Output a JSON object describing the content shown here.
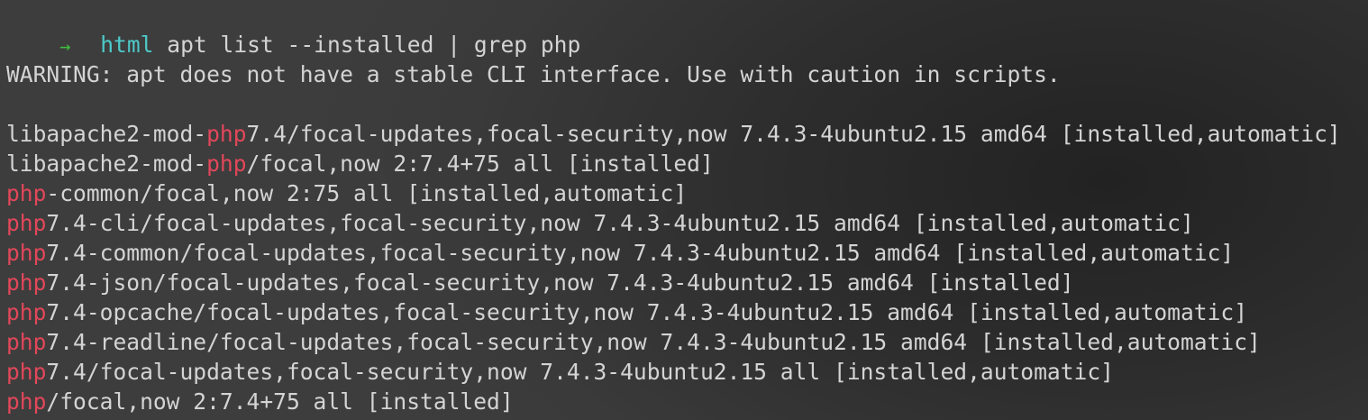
{
  "theme": {
    "background": "#3b3b3b",
    "foreground": "#d4d4d4",
    "prompt_arrow_color": "#3fbf3f",
    "prompt_dir_color": "#4ec9c9",
    "match_highlight_color": "#e2475a"
  },
  "prompt": {
    "arrow": "→",
    "directory": "html",
    "command": "apt list --installed | grep php"
  },
  "warning": "WARNING: apt does not have a stable CLI interface. Use with caution in scripts.",
  "results": [
    {
      "pre": "libapache2-mod-",
      "match": "php",
      "post": "7.4/focal-updates,focal-security,now 7.4.3-4ubuntu2.15 amd64 [installed,automatic]"
    },
    {
      "pre": "libapache2-mod-",
      "match": "php",
      "post": "/focal,now 2:7.4+75 all [installed]"
    },
    {
      "pre": "",
      "match": "php",
      "post": "-common/focal,now 2:75 all [installed,automatic]"
    },
    {
      "pre": "",
      "match": "php",
      "post": "7.4-cli/focal-updates,focal-security,now 7.4.3-4ubuntu2.15 amd64 [installed,automatic]"
    },
    {
      "pre": "",
      "match": "php",
      "post": "7.4-common/focal-updates,focal-security,now 7.4.3-4ubuntu2.15 amd64 [installed,automatic]"
    },
    {
      "pre": "",
      "match": "php",
      "post": "7.4-json/focal-updates,focal-security,now 7.4.3-4ubuntu2.15 amd64 [installed]"
    },
    {
      "pre": "",
      "match": "php",
      "post": "7.4-opcache/focal-updates,focal-security,now 7.4.3-4ubuntu2.15 amd64 [installed,automatic]"
    },
    {
      "pre": "",
      "match": "php",
      "post": "7.4-readline/focal-updates,focal-security,now 7.4.3-4ubuntu2.15 amd64 [installed,automatic]"
    },
    {
      "pre": "",
      "match": "php",
      "post": "7.4/focal-updates,focal-security,now 7.4.3-4ubuntu2.15 all [installed,automatic]"
    },
    {
      "pre": "",
      "match": "php",
      "post": "/focal,now 2:7.4+75 all [installed]"
    }
  ]
}
